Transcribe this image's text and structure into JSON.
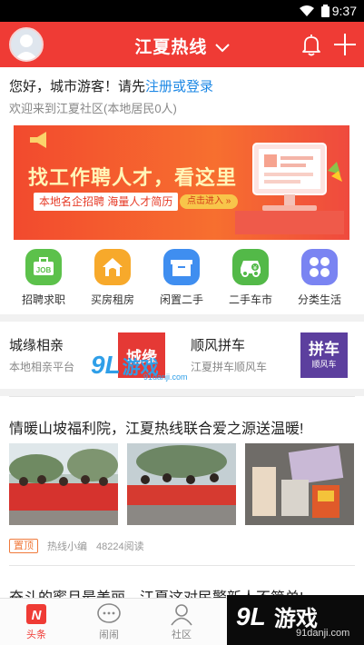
{
  "status_bar": {
    "time": "9:37"
  },
  "header": {
    "title": "江夏热线"
  },
  "welcome": {
    "greeting": "您好，城市游客！请先",
    "login_link": "注册或登录",
    "subtitle": "欢迎来到江夏社区(本地居民0人)"
  },
  "banner": {
    "headline": "找工作聘人才，看这里",
    "subline": "本地名企招聘 海量人才简历",
    "cta": "点击进入 »"
  },
  "categories": [
    {
      "label": "招聘求职",
      "color": "#5cc14b",
      "icon": "job-icon"
    },
    {
      "label": "买房租房",
      "color": "#f7a92b",
      "icon": "house-icon"
    },
    {
      "label": "闲置二手",
      "color": "#3f8ef0",
      "icon": "box-icon"
    },
    {
      "label": "二手车市",
      "color": "#53b948",
      "icon": "car-icon"
    },
    {
      "label": "分类生活",
      "color": "#7a84f2",
      "icon": "clover-icon"
    }
  ],
  "promos": [
    {
      "title": "城缘相亲",
      "subtitle": "本地相亲平台",
      "image_text": "城缘",
      "image_color": "#e53935"
    },
    {
      "title": "顺风拼车",
      "subtitle": "江夏拼车顺风车",
      "image_text": "拼车",
      "image_sub": "顺风车",
      "image_color": "#5c3f9e"
    }
  ],
  "article": {
    "title": "情暖山坡福利院，江夏热线联合爱之源送温暖!",
    "tag": "置顶",
    "author": "热线小编",
    "reads": "48224阅读"
  },
  "article2": {
    "title": "奋斗的蜜月最美丽，江夏这对民警新人不简单!"
  },
  "tabs": [
    {
      "label": "头条",
      "active": true
    },
    {
      "label": "闹闹",
      "active": false
    },
    {
      "label": "社区",
      "active": false
    }
  ],
  "watermark": {
    "logo": "9L",
    "text": "游戏",
    "url": "91danji.com"
  },
  "corner_watermark": {
    "logo": "9L",
    "text": "游戏",
    "url": "91danji.com"
  }
}
